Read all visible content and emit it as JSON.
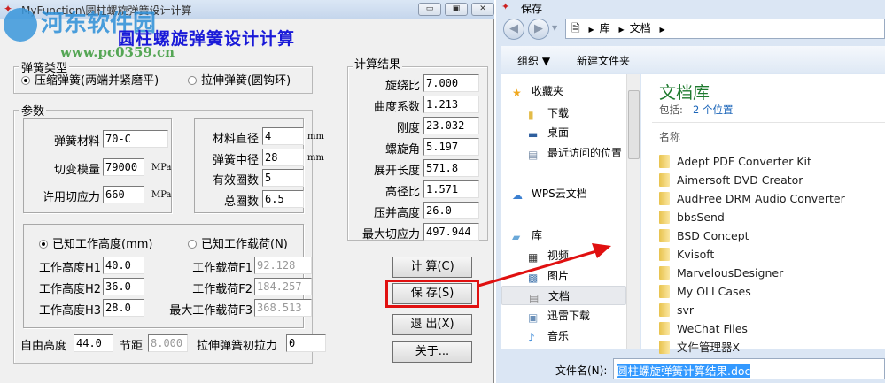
{
  "app": {
    "title": "MyFunction\\圆柱螺旋弹簧设计计算",
    "heading": "圆柱螺旋弹簧设计计算",
    "watermark": "河东软件园",
    "watermark_url": "www.pc0359.cn",
    "window_buttons": [
      "▭",
      "▣",
      "✕"
    ]
  },
  "spring_type": {
    "label": "弹簧类型",
    "options": [
      "压缩弹簧(两端并紧磨平)",
      "拉伸弹簧(圆钩环)"
    ],
    "selected": 0
  },
  "params": {
    "label": "参数",
    "material": {
      "label": "弹簧材料",
      "value": "70-C"
    },
    "shear_modulus": {
      "label": "切变模量",
      "value": "79000",
      "unit": "MPa"
    },
    "allow_stress": {
      "label": "许用切应力",
      "value": "660",
      "unit": "MPa"
    },
    "wire_dia": {
      "label": "材料直径",
      "value": "4",
      "unit": "mm"
    },
    "mean_dia": {
      "label": "弹簧中径",
      "value": "28",
      "unit": "mm"
    },
    "active_coils": {
      "label": "有效圈数",
      "value": "5"
    },
    "total_coils": {
      "label": "总圈数",
      "value": "6.5"
    },
    "mode_options": [
      "已知工作高度(mm)",
      "已知工作载荷(N)"
    ],
    "mode_selected": 0,
    "heights": [
      {
        "label": "工作高度H1",
        "value": "40.0"
      },
      {
        "label": "工作高度H2",
        "value": "36.0"
      },
      {
        "label": "工作高度H3",
        "value": "28.0"
      }
    ],
    "loads": [
      {
        "label": "工作载荷F1",
        "value": "92.128"
      },
      {
        "label": "工作载荷F2",
        "value": "184.257"
      },
      {
        "label": "最大工作载荷F3",
        "value": "368.513"
      }
    ],
    "free_height": {
      "label": "自由高度",
      "value": "44.0"
    },
    "pitch": {
      "label": "节距",
      "value": "8.000"
    },
    "init_tension": {
      "label": "拉伸弹簧初拉力",
      "value": "0"
    }
  },
  "results": {
    "label": "计算结果",
    "rows": [
      {
        "label": "旋绕比",
        "value": "7.000"
      },
      {
        "label": "曲度系数",
        "value": "1.213"
      },
      {
        "label": "刚度",
        "value": "23.032"
      },
      {
        "label": "螺旋角",
        "value": "5.197"
      },
      {
        "label": "展开长度",
        "value": "571.8"
      },
      {
        "label": "高径比",
        "value": "1.571"
      },
      {
        "label": "压并高度",
        "value": "26.0"
      },
      {
        "label": "最大切应力",
        "value": "497.944"
      }
    ]
  },
  "buttons": {
    "calc": "计 算(C)",
    "save": "保 存(S)",
    "exit": "退 出(X)",
    "about": "关于..."
  },
  "highlight_color": "#e01010",
  "dialog": {
    "title": "保存",
    "breadcrumb": [
      "库",
      "文档"
    ],
    "toolbar": {
      "organize": "组织 ▼",
      "new_folder": "新建文件夹"
    },
    "nav": [
      {
        "label": "收藏夹",
        "icon": "star-icon"
      },
      {
        "label": "下载",
        "icon": "folder-icon"
      },
      {
        "label": "桌面",
        "icon": "desktop-icon"
      },
      {
        "label": "最近访问的位置",
        "icon": "recent-icon"
      },
      {
        "label": "WPS云文档",
        "icon": "cloud-icon"
      },
      {
        "label": "库",
        "icon": "library-icon"
      },
      {
        "label": "视频",
        "icon": "video-icon"
      },
      {
        "label": "图片",
        "icon": "picture-icon"
      },
      {
        "label": "文档",
        "icon": "document-icon"
      },
      {
        "label": "迅雷下载",
        "icon": "download-icon"
      },
      {
        "label": "音乐",
        "icon": "music-icon"
      }
    ],
    "nav_selected": "文档",
    "library_title": "文档库",
    "includes_label": "包括:",
    "includes_link": "2 个位置",
    "column_name": "名称",
    "files": [
      "Adept PDF Converter Kit",
      "Aimersoft DVD Creator",
      "AudFree DRM Audio Converter",
      "bbsSend",
      "BSD Concept",
      "Kvisoft",
      "MarvelousDesigner",
      "My OLI Cases",
      "svr",
      "WeChat Files",
      "文件管理器X"
    ],
    "filename_label": "文件名(N):",
    "filename_value": "圆柱螺旋弹簧计算结果.doc"
  }
}
